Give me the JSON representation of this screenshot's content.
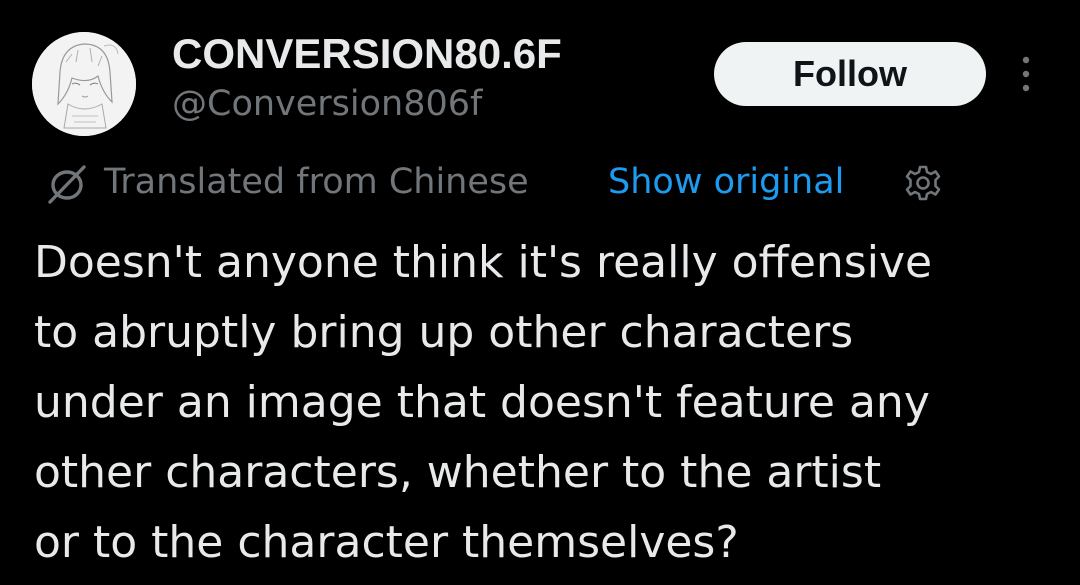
{
  "author": {
    "display_name": "CONVERSION80.6F",
    "handle": "@Conversion806f",
    "avatar_icon": "anime-sketch-avatar"
  },
  "actions": {
    "follow_label": "Follow",
    "more_icon": "more-vertical-icon"
  },
  "translation": {
    "icon": "translate-slash-icon",
    "label": "Translated from Chinese",
    "show_original_label": "Show original",
    "settings_icon": "gear-icon"
  },
  "tweet": {
    "lines": [
      "Doesn't anyone think it's really offensive",
      "to abruptly bring up other characters",
      "under an image that doesn't feature any",
      "other characters, whether to the artist",
      "or to the character themselves?"
    ]
  },
  "colors": {
    "background": "#000000",
    "primary_text": "#e7e9ea",
    "secondary_text": "#71767b",
    "link": "#1d9bf0",
    "follow_bg": "#eff3f4",
    "follow_text": "#0f1419"
  }
}
